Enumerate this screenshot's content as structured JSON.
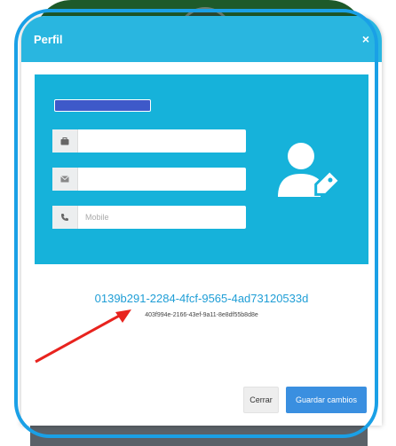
{
  "modal": {
    "title": "Perfil",
    "close_glyph": "×"
  },
  "form": {
    "email_placeholder": "",
    "address_placeholder": "",
    "mobile_placeholder": "Mobile",
    "field_icons": [
      "briefcase-icon",
      "envelope-icon",
      "phone-icon"
    ]
  },
  "profile": {
    "avatar_icon": "user-tag-icon",
    "uuid_primary": "0139b291-2284-4fcf-9565-4ad73120533d",
    "uuid_secondary": "403f994e-2166-43ef-9a11-8e8df55b8d8e"
  },
  "footer": {
    "cancel_label": "Cerrar",
    "save_label": "Guardar cambios"
  },
  "colors": {
    "header": "#29b6e0",
    "panel": "#16b2da",
    "highlight_frame": "#1aa0e6",
    "arrow": "#e8231e",
    "primary_button": "#3a8fe0"
  }
}
